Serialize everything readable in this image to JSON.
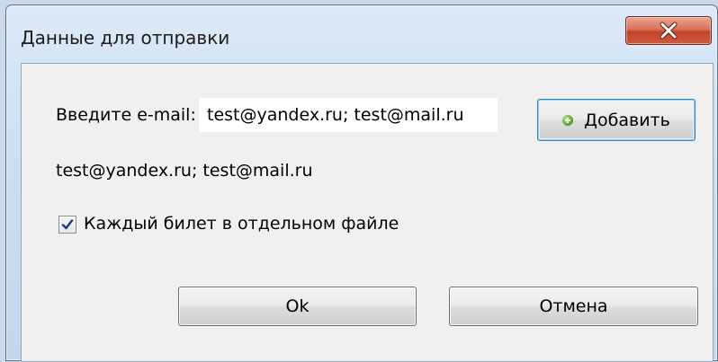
{
  "window": {
    "title": "Данные для отправки",
    "close_icon": "close-x-icon",
    "close_button_color": "#c8462c"
  },
  "form": {
    "email_label": "Введите e-mail:",
    "email_value": "test@yandex.ru; test@mail.ru",
    "add_button_label": "Добавить",
    "add_icon": "green-plus-icon",
    "recipients_text": "test@yandex.ru; test@mail.ru",
    "checkbox_label": "Каждый билет в отдельном файле",
    "checkbox_checked": true
  },
  "buttons": {
    "ok_label": "Ok",
    "cancel_label": "Отмена"
  }
}
